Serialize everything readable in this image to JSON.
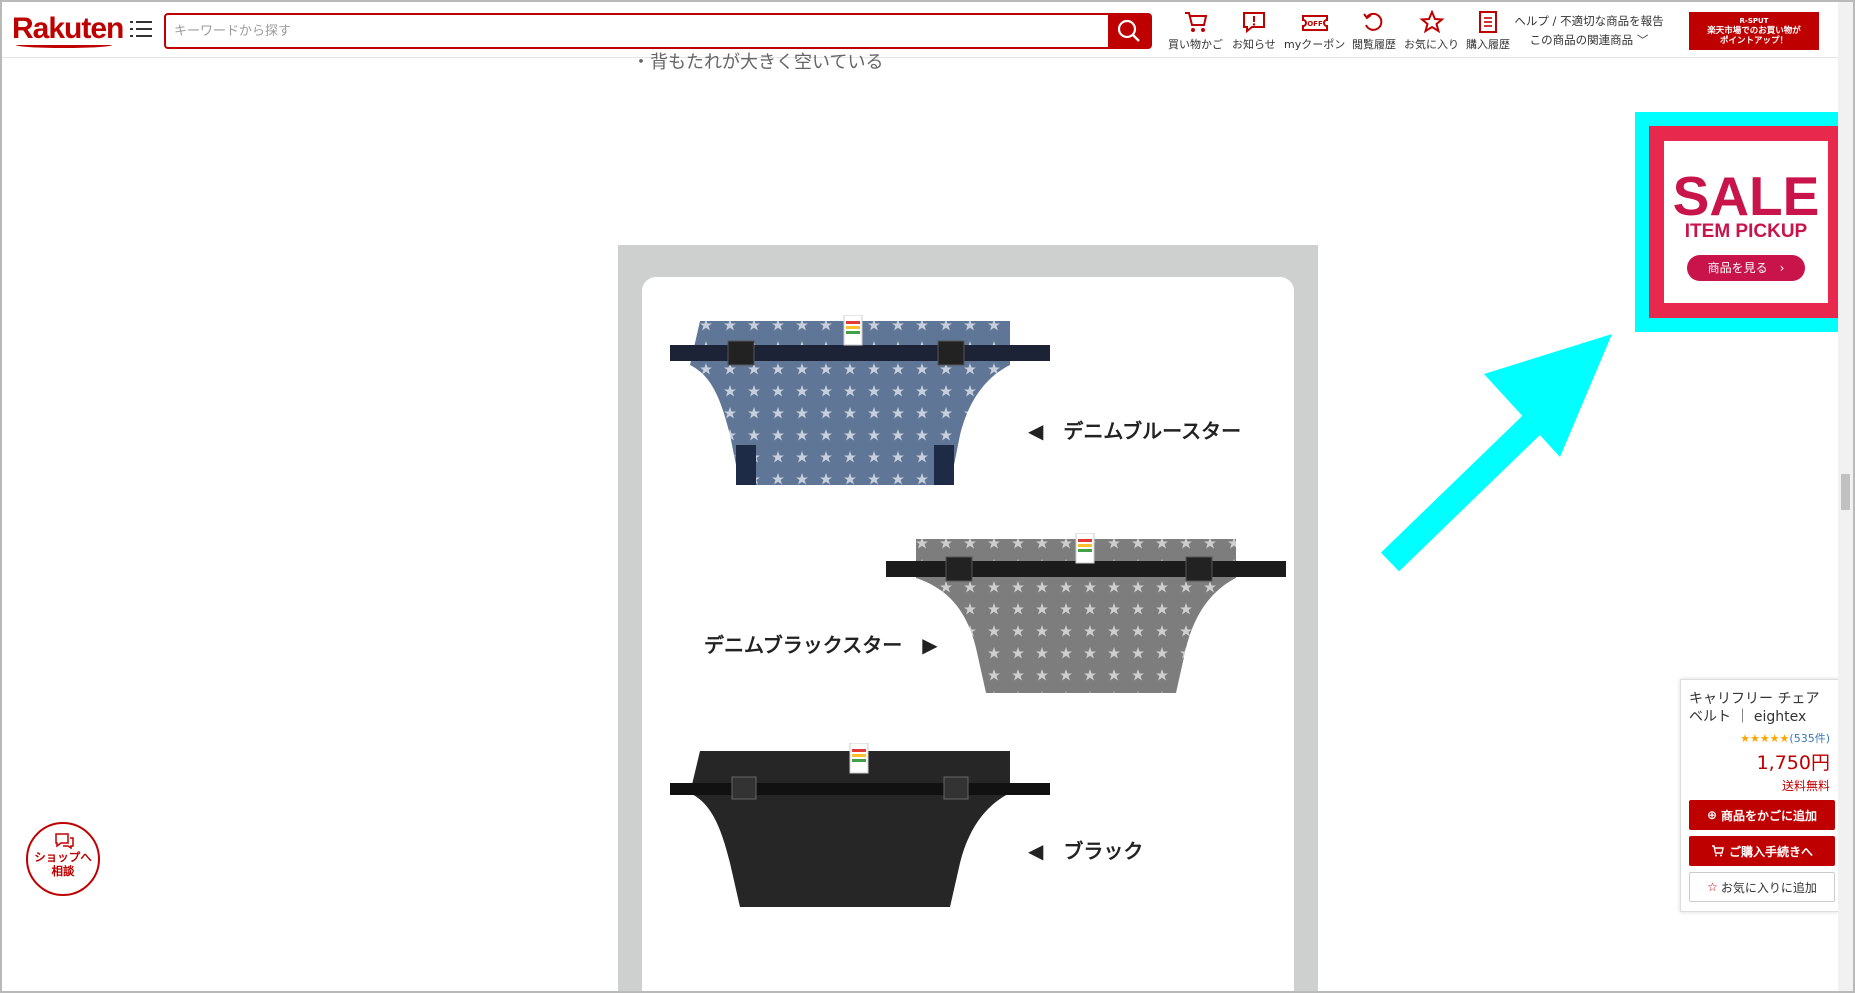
{
  "header": {
    "logo": "Rakuten",
    "search_placeholder": "キーワードから探す",
    "nav": [
      {
        "label": "買い物かご",
        "icon": "cart-icon"
      },
      {
        "label": "お知らせ",
        "icon": "notification-icon"
      },
      {
        "label": "myクーポン",
        "icon": "coupon-icon"
      },
      {
        "label": "閲覧履歴",
        "icon": "history-icon"
      },
      {
        "label": "お気に入り",
        "icon": "star-icon"
      },
      {
        "label": "購入履歴",
        "icon": "receipt-icon"
      }
    ],
    "help_line1": "ヘルプ / 不適切な商品を報告",
    "help_line2": "この商品の関連商品",
    "banner_tag": "R-SPUT",
    "banner_line1": "楽天市場でのお買い物が",
    "banner_line2": "ポイントアップ！"
  },
  "page": {
    "cut_text": "・背もたれが大きく空いている"
  },
  "variants": [
    {
      "label": "◀　デニムブルースター",
      "color": "#5f7696"
    },
    {
      "label": "デニムブラックスター　▶",
      "color": "#7d7d7d"
    },
    {
      "label": "◀　ブラック",
      "color": "#262626"
    }
  ],
  "sale_banner": {
    "title": "SALE",
    "subtitle": "ITEM PICKUP",
    "button": "商品を見る　›"
  },
  "cart_widget": {
    "title": "キャリフリー チェアベルト ｜ eightex 国…",
    "stars": "★★★★★",
    "review_count": "(535件)",
    "price": "1,750円",
    "shipping": "送料無料",
    "add_to_cart": "商品をかごに追加",
    "checkout": "ご購入手続きへ",
    "favorite": "お気に入りに追加"
  },
  "chat": {
    "line1": "ショップへ",
    "line2": "相談"
  },
  "colors": {
    "brand": "#bf0000",
    "highlight": "#00ffff",
    "sale": "#c8144a"
  }
}
